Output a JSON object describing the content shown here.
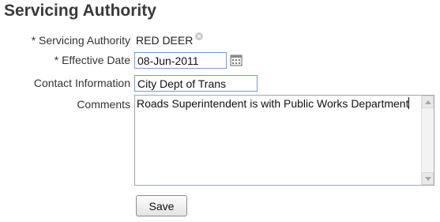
{
  "page": {
    "title": "Servicing Authority"
  },
  "form": {
    "servicing_authority": {
      "label": "* Servicing Authority",
      "value": "RED DEER",
      "clear_icon": "clear-icon"
    },
    "effective_date": {
      "label": "* Effective Date",
      "value": "08-Jun-2011",
      "picker_icon": "calendar-icon"
    },
    "contact_information": {
      "label": "Contact Information",
      "value": "City Dept of Trans"
    },
    "comments": {
      "label": "Comments",
      "value": "Roads Superintendent is with Public Works Department"
    }
  },
  "actions": {
    "save_label": "Save"
  }
}
